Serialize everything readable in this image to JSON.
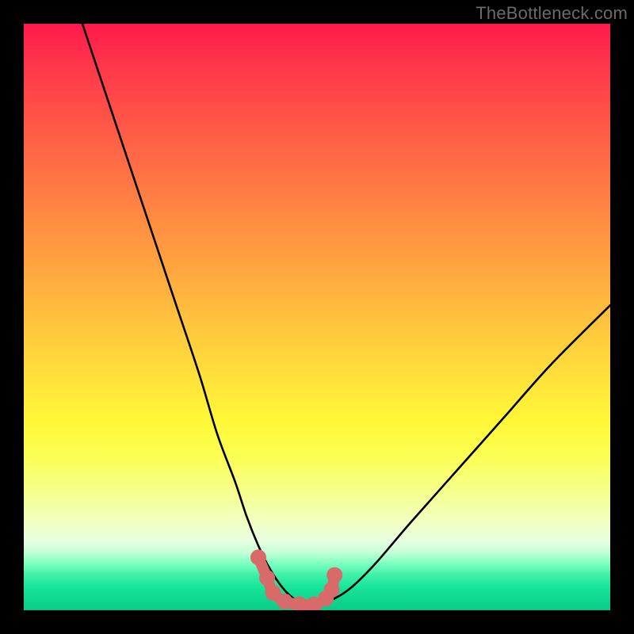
{
  "watermark": "TheBottleneck.com",
  "chart_data": {
    "type": "line",
    "title": "",
    "xlabel": "",
    "ylabel": "",
    "xlim": [
      0,
      100
    ],
    "ylim": [
      0,
      100
    ],
    "series": [
      {
        "name": "bottleneck-curve",
        "x": [
          10,
          14,
          18,
          22,
          26,
          30,
          33,
          36,
          38,
          40,
          42,
          44,
          46,
          48,
          50,
          53,
          56,
          60,
          66,
          74,
          82,
          90,
          100
        ],
        "values": [
          100,
          88,
          76,
          64,
          52,
          40,
          30,
          22,
          16,
          11,
          7,
          4,
          2,
          1,
          1,
          2,
          4,
          8,
          15,
          24,
          33,
          42,
          52
        ]
      }
    ],
    "markers": {
      "name": "highlight-dots",
      "color": "#d86a6a",
      "points": [
        {
          "x": 40.0,
          "y": 9.0
        },
        {
          "x": 41.5,
          "y": 5.5
        },
        {
          "x": 42.5,
          "y": 3.0
        },
        {
          "x": 44.5,
          "y": 1.5
        },
        {
          "x": 47.0,
          "y": 1.0
        },
        {
          "x": 49.5,
          "y": 1.0
        },
        {
          "x": 51.5,
          "y": 2.0
        },
        {
          "x": 52.5,
          "y": 3.5
        },
        {
          "x": 53.0,
          "y": 6.0
        }
      ]
    },
    "background_gradient": {
      "direction": "vertical",
      "stops": [
        {
          "pos": 0.0,
          "color": "#ff1a4d"
        },
        {
          "pos": 0.5,
          "color": "#ffda3b"
        },
        {
          "pos": 0.8,
          "color": "#f6ff8f"
        },
        {
          "pos": 1.0,
          "color": "#08cc85"
        }
      ]
    }
  }
}
